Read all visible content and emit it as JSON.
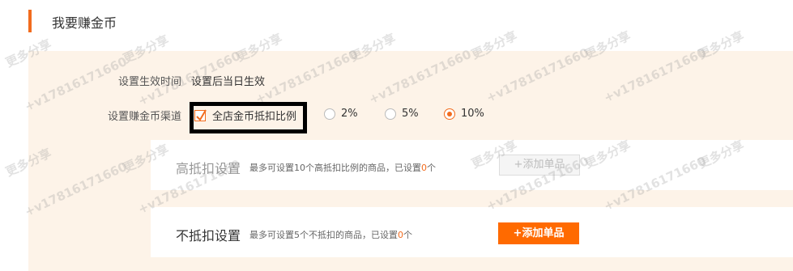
{
  "section": {
    "title": "我要赚金币"
  },
  "settings": {
    "effective_time": {
      "label": "设置生效时间",
      "value": "设置后当日生效"
    },
    "channel": {
      "label": "设置赚金币渠道",
      "checkbox_label": "全店金币抵扣比例",
      "checkbox_checked": true,
      "options": [
        {
          "label": "2%",
          "selected": false
        },
        {
          "label": "5%",
          "selected": false
        },
        {
          "label": "10%",
          "selected": true
        }
      ]
    }
  },
  "high_deduct": {
    "title": "高抵扣设置",
    "desc_prefix": "最多可设置10个高抵扣比例的商品，已设置",
    "count": "0",
    "desc_suffix": "个",
    "add_button": "+添加单品",
    "add_button_enabled": false
  },
  "no_deduct": {
    "title": "不抵扣设置",
    "desc_prefix": "最多可设置5个不抵扣的商品，已设置",
    "count": "0",
    "desc_suffix": "个",
    "add_button": "+添加单品",
    "add_button_enabled": true
  },
  "colors": {
    "accent": "#f26c1e",
    "button": "#ff6a00",
    "panel_bg": "#fdf3e8"
  },
  "watermark": {
    "brand": "更多分享",
    "contact": "+v17816171660"
  }
}
